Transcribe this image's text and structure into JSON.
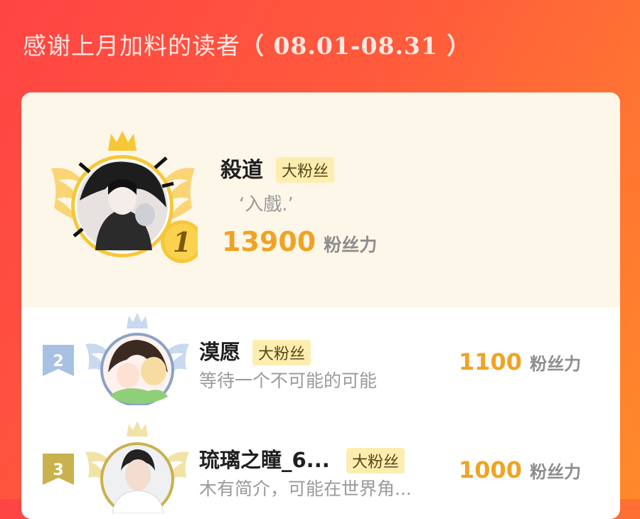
{
  "header": {
    "title_main": "感谢上月加料的读者",
    "title_range": "（ 08.01-08.31 ）"
  },
  "colors": {
    "gold": "#f0a323",
    "badge_bg": "#fdeeb0",
    "silver": "#a8c1e3",
    "bronze": "#c9b14d"
  },
  "top_fan": {
    "rank": "1",
    "name": "殺道",
    "badge": "大粉丝",
    "bio": "‘入戲.’",
    "score": "13900",
    "unit": "粉丝力",
    "avatar_icon": "crowned-avatar-gold"
  },
  "fans": [
    {
      "rank": "2",
      "name": "漠愿",
      "badge": "大粉丝",
      "bio": "等待一个不可能的可能",
      "score": "1100",
      "unit": "粉丝力"
    },
    {
      "rank": "3",
      "name": "琉璃之瞳_6...",
      "badge": "大粉丝",
      "bio": "木有简介，可能在世界角...",
      "score": "1000",
      "unit": "粉丝力"
    }
  ]
}
